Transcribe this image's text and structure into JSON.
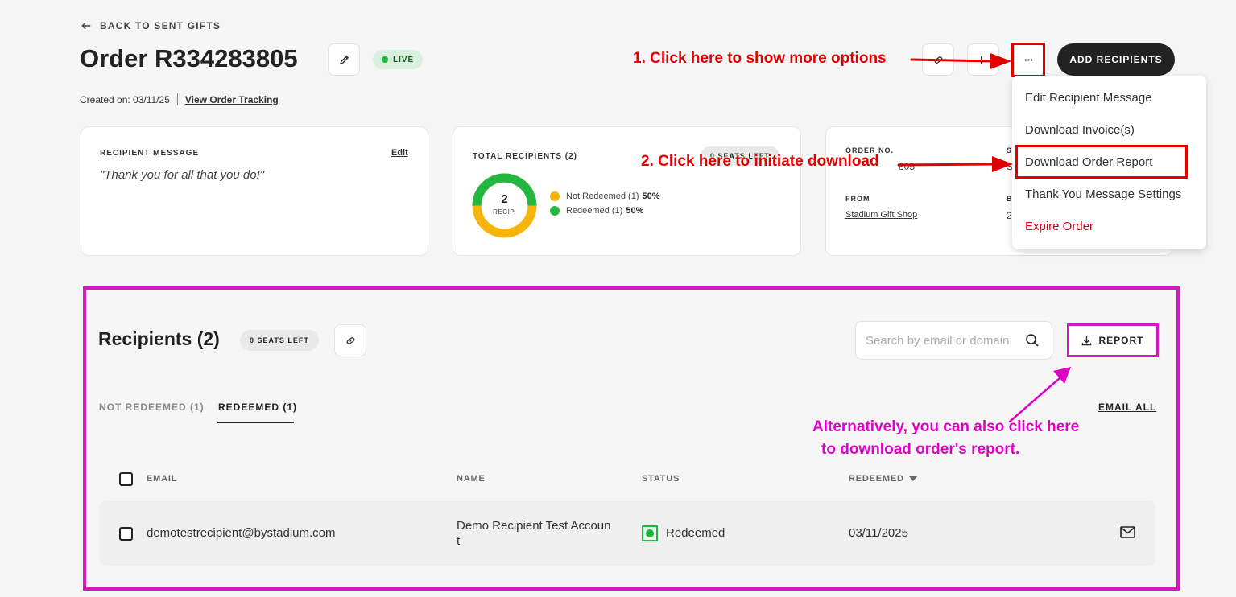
{
  "header": {
    "back_label": "BACK TO SENT GIFTS",
    "order_title": "Order R334283805",
    "status_badge": "LIVE",
    "created_label": "Created on: 03/11/25",
    "tracking_link": "View Order Tracking",
    "add_recipients_label": "ADD RECIPIENTS"
  },
  "cards": {
    "message": {
      "label": "RECIPIENT MESSAGE",
      "edit": "Edit",
      "text": "\"Thank you for all that you do!\""
    },
    "recipients": {
      "label": "TOTAL RECIPIENTS (2)",
      "seats": "0 SEATS LEFT",
      "donut_count": "2",
      "donut_sub": "RECIP.",
      "legend": [
        {
          "label": "Not Redeemed (1)",
          "pct": "50%",
          "color": "#f5b50b"
        },
        {
          "label": "Redeemed (1)",
          "pct": "50%",
          "color": "#22b83f"
        }
      ]
    },
    "order": {
      "label_no": "ORDER NO.",
      "order_no_partial": "805",
      "label_from": "FROM",
      "from_value": "Stadium Gift Shop",
      "col2_label_partial": "S",
      "col2_value_partial": "S",
      "col2_label2_partial": "B",
      "col2_value2_partial": "2"
    }
  },
  "menu": {
    "items": [
      "Edit Recipient Message",
      "Download Invoice(s)",
      "Download Order Report",
      "Thank You Message Settings",
      "Expire Order"
    ]
  },
  "annotations": {
    "step1": "1. Click here to show more options",
    "step2": "2. Click here to initiate download",
    "alt_line1": "Alternatively, you can also click here",
    "alt_line2": "to download order's report."
  },
  "recipients": {
    "title": "Recipients (2)",
    "seats": "0 SEATS LEFT",
    "search_placeholder": "Search by email or domain",
    "report_label": "REPORT",
    "tabs": [
      "NOT REDEEMED (1)",
      "REDEEMED (1)"
    ],
    "email_all": "EMAIL ALL",
    "columns": [
      "EMAIL",
      "NAME",
      "STATUS",
      "REDEEMED"
    ],
    "rows": [
      {
        "email": "demotestrecipient@bystadium.com",
        "name_line1": "Demo Recipient Test Accoun",
        "name_line2": "t",
        "status": "Redeemed",
        "redeemed": "03/11/2025"
      }
    ]
  },
  "colors": {
    "annotation_red": "#e00000",
    "annotation_magenta": "#d21ac0",
    "dark_button": "#222222",
    "live_green": "#19b83c"
  }
}
